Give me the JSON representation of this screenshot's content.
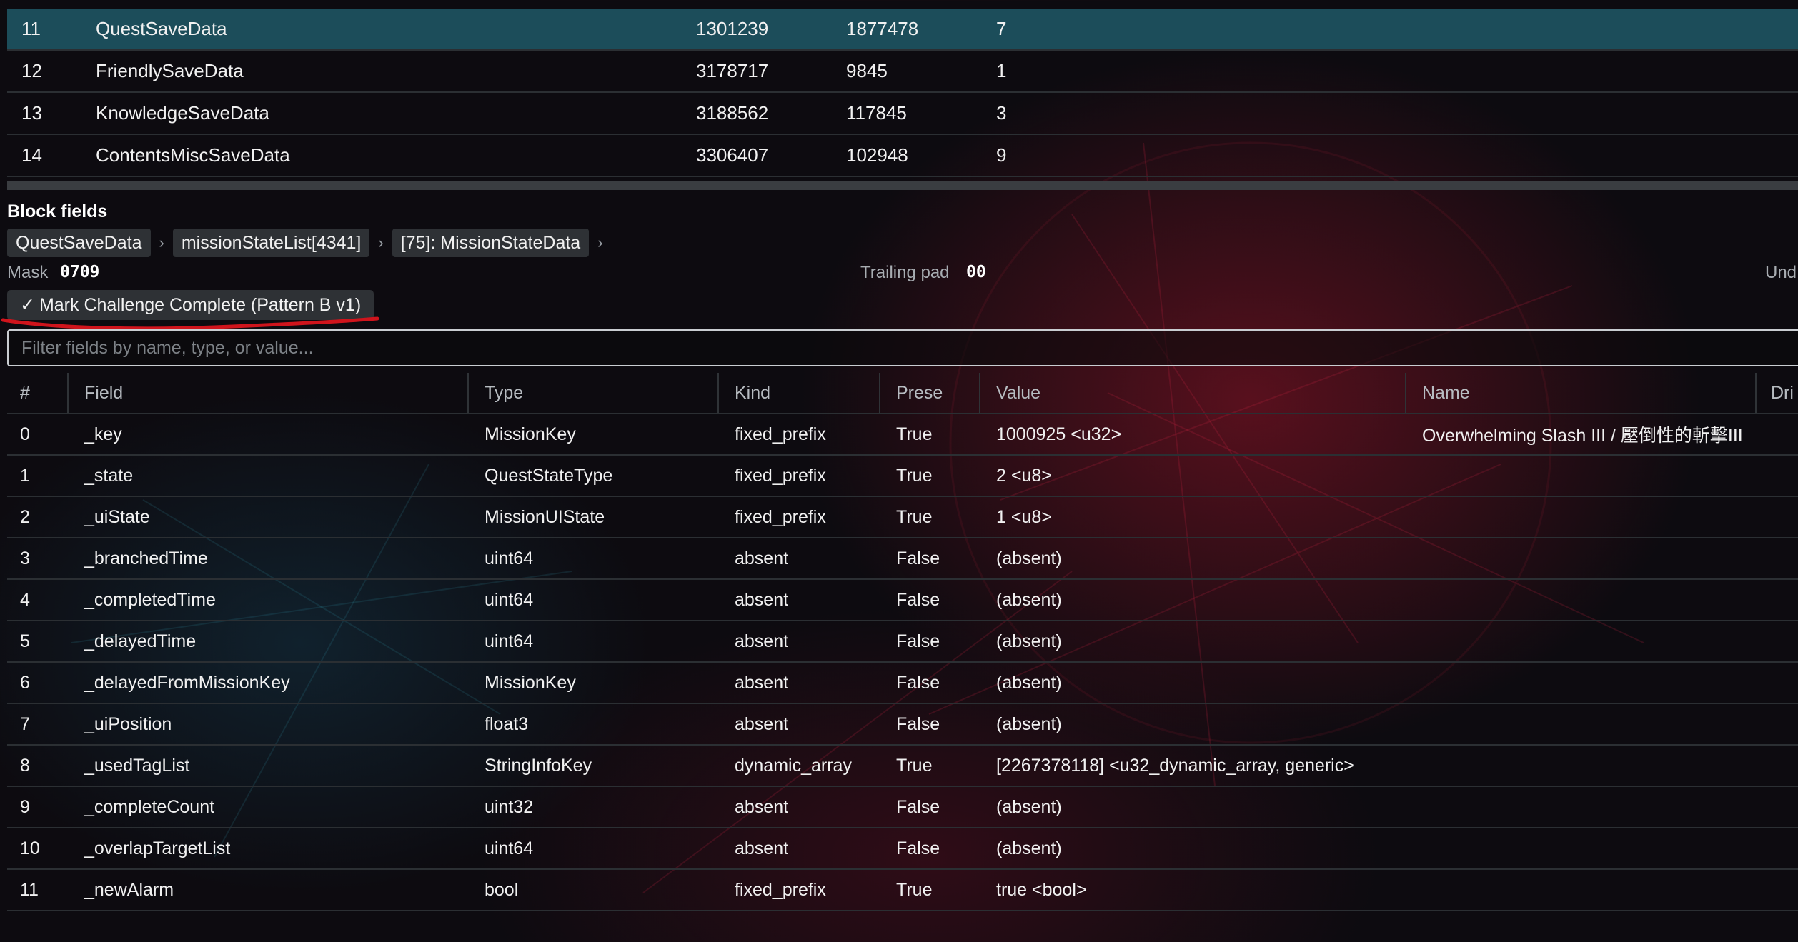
{
  "blocks": {
    "rows": [
      {
        "idx": "11",
        "name": "QuestSaveData",
        "offset": "1301239",
        "size": "1877478",
        "count": "7",
        "selected": true
      },
      {
        "idx": "12",
        "name": "FriendlySaveData",
        "offset": "3178717",
        "size": "9845",
        "count": "1"
      },
      {
        "idx": "13",
        "name": "KnowledgeSaveData",
        "offset": "3188562",
        "size": "117845",
        "count": "3"
      },
      {
        "idx": "14",
        "name": "ContentsMiscSaveData",
        "offset": "3306407",
        "size": "102948",
        "count": "9"
      }
    ]
  },
  "block_fields": {
    "title": "Block fields",
    "breadcrumb": [
      "QuestSaveData",
      "missionStateList[4341]",
      "[75]: MissionStateData"
    ],
    "breadcrumb_sep": "›",
    "mask_label": "Mask",
    "mask_value": "0709",
    "trailing_label": "Trailing pad",
    "trailing_value": "00",
    "und_label": "Und",
    "mark_button_check": "✓",
    "mark_button_label": "Mark Challenge Complete (Pattern B v1)",
    "filter_placeholder": "Filter fields by name, type, or value...",
    "filter_value": ""
  },
  "fields": {
    "headers": [
      "#",
      "Field",
      "Type",
      "Kind",
      "Prese",
      "Value",
      "Name",
      "Dri"
    ],
    "rows": [
      [
        "0",
        "_key",
        "MissionKey",
        "fixed_prefix",
        "True",
        "1000925 <u32>",
        "Overwhelming Slash III / 壓倒性的斬擊III"
      ],
      [
        "1",
        "_state",
        "QuestStateType",
        "fixed_prefix",
        "True",
        "2 <u8>",
        ""
      ],
      [
        "2",
        "_uiState",
        "MissionUIState",
        "fixed_prefix",
        "True",
        "1 <u8>",
        ""
      ],
      [
        "3",
        "_branchedTime",
        "uint64",
        "absent",
        "False",
        "(absent)",
        ""
      ],
      [
        "4",
        "_completedTime",
        "uint64",
        "absent",
        "False",
        "(absent)",
        ""
      ],
      [
        "5",
        "_delayedTime",
        "uint64",
        "absent",
        "False",
        "(absent)",
        ""
      ],
      [
        "6",
        "_delayedFromMissionKey",
        "MissionKey",
        "absent",
        "False",
        "(absent)",
        ""
      ],
      [
        "7",
        "_uiPosition",
        "float3",
        "absent",
        "False",
        "(absent)",
        ""
      ],
      [
        "8",
        "_usedTagList",
        "StringInfoKey",
        "dynamic_array",
        "True",
        "[2267378118] <u32_dynamic_array, generic>",
        ""
      ],
      [
        "9",
        "_completeCount",
        "uint32",
        "absent",
        "False",
        "(absent)",
        ""
      ],
      [
        "10",
        "_overlapTargetList",
        "uint64",
        "absent",
        "False",
        "(absent)",
        ""
      ],
      [
        "11",
        "_newAlarm",
        "bool",
        "fixed_prefix",
        "True",
        "true <bool>",
        ""
      ]
    ]
  },
  "colors": {
    "selected_row": "#1c4d5a",
    "annotation": "#d0141c",
    "chip_bg": "#2e3135"
  },
  "icons": {
    "check": "check-icon",
    "chevron": "chevron-right-icon"
  }
}
